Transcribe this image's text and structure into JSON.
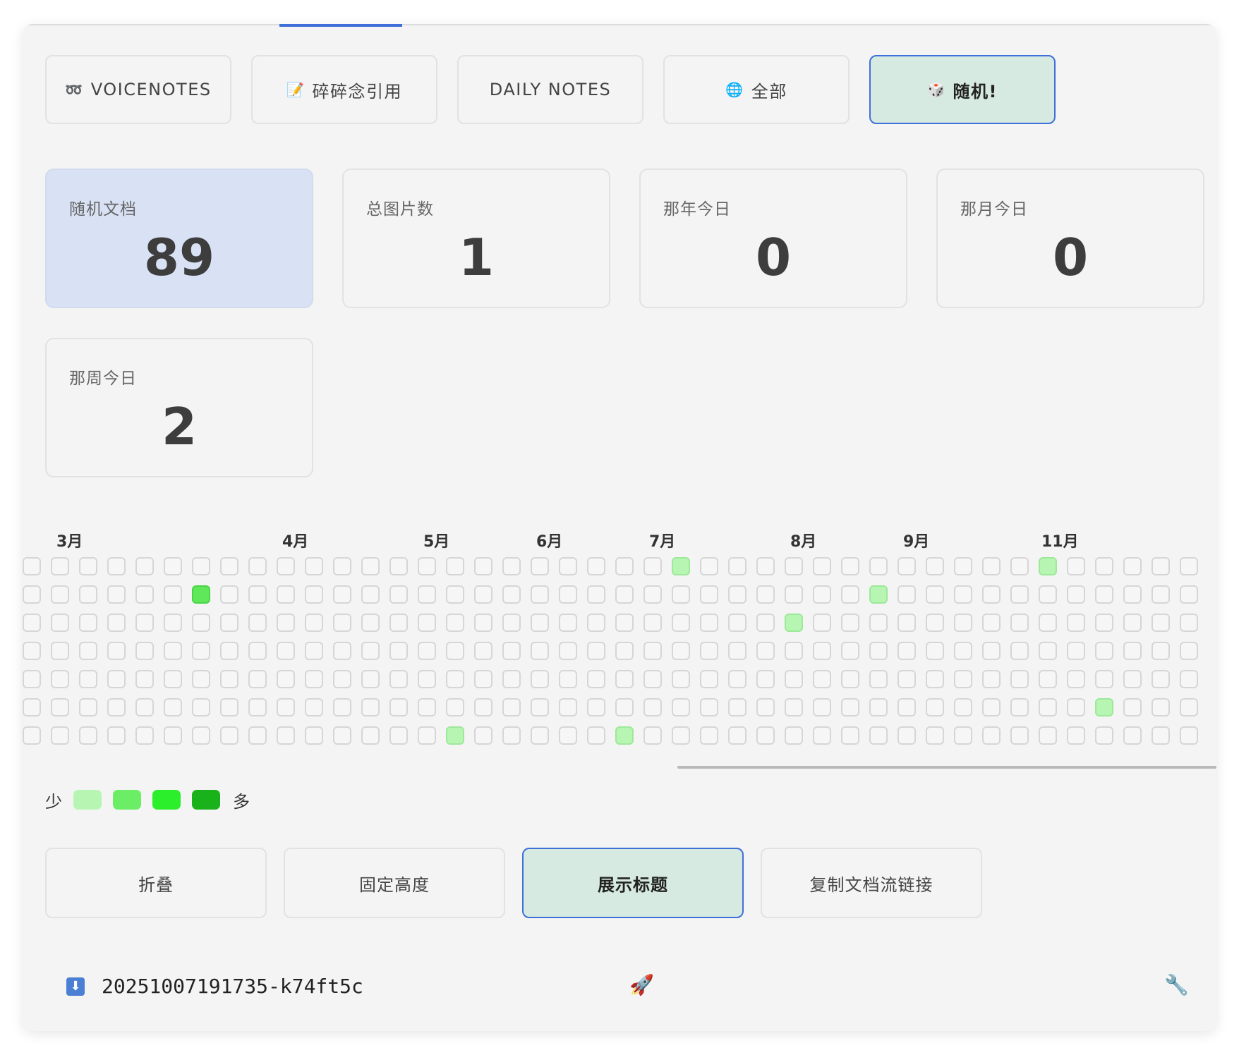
{
  "tabs": [
    {
      "icon": "➿",
      "label": "VOICENOTES"
    },
    {
      "icon": "📝",
      "label": "碎碎念引用"
    },
    {
      "icon": "",
      "label": "DAILY NOTES"
    },
    {
      "icon": "🌐",
      "label": "全部"
    },
    {
      "icon": "🎲",
      "label": "随机!",
      "active": true
    }
  ],
  "stats": [
    {
      "label": "随机文档",
      "value": "89"
    },
    {
      "label": "总图片数",
      "value": "1"
    },
    {
      "label": "那年今日",
      "value": "0"
    },
    {
      "label": "那月今日",
      "value": "0"
    },
    {
      "label": "那周今日",
      "value": "2"
    }
  ],
  "heatmap": {
    "months": [
      "3月",
      "4月",
      "5月",
      "6月",
      "7月",
      "8月",
      "9月",
      "11月"
    ],
    "active_cells": [
      {
        "col": 22,
        "row": 0,
        "level": 1
      },
      {
        "col": 35,
        "row": 0,
        "level": 1
      },
      {
        "col": 5,
        "row": 1,
        "level": 2
      },
      {
        "col": 29,
        "row": 1,
        "level": 1
      },
      {
        "col": 26,
        "row": 2,
        "level": 1
      },
      {
        "col": 37,
        "row": 5,
        "level": 1
      },
      {
        "col": 14,
        "row": 6,
        "level": 1
      },
      {
        "col": 20,
        "row": 6,
        "level": 1
      }
    ],
    "legend": {
      "less": "少",
      "more": "多",
      "colors": [
        "#b7f5b3",
        "#6bee66",
        "#2aef2a",
        "#1ab21a"
      ]
    }
  },
  "actions": [
    {
      "label": "折叠"
    },
    {
      "label": "固定高度"
    },
    {
      "label": "展示标题",
      "active": true
    },
    {
      "label": "复制文档流链接"
    }
  ],
  "footer": {
    "doc_icon": "⬇",
    "doc_id": "20251007191735-k74ft5c",
    "rocket_icon": "🚀",
    "wrench_icon": "🔧"
  }
}
